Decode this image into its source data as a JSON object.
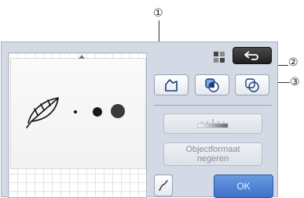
{
  "callouts": {
    "c1": "①",
    "c2": "②",
    "c3": "③"
  },
  "buttons": {
    "back": {
      "icon": "return-arrow-icon"
    },
    "view_toggle": {
      "icon": "grid-view-icon"
    },
    "outline_detect": {
      "icon": "outline-detect-icon"
    },
    "inner_outline": {
      "icon": "inner-outline-icon"
    },
    "outer_outline": {
      "icon": "outer-outline-icon"
    },
    "threshold": {
      "icon": "threshold-slider-icon"
    },
    "ignore_size": {
      "label_line1": "Objectformaat",
      "label_line2": "negeren"
    },
    "curve": {
      "icon": "curve-line-icon"
    },
    "ok": {
      "label": "OK"
    }
  },
  "colors": {
    "screen_bg": "#d3d9e5",
    "accent_blue": "#3d72c9",
    "back_button": "#2b2b2b",
    "callout_line": "#333333"
  }
}
